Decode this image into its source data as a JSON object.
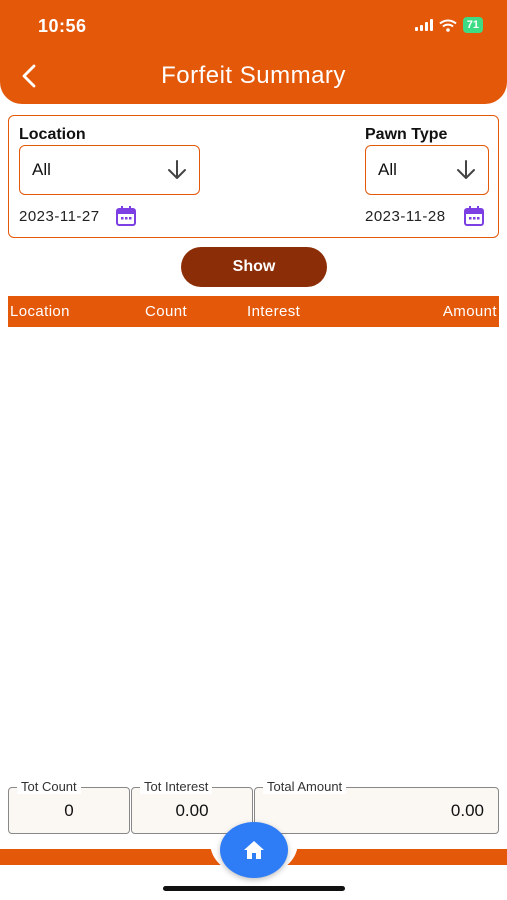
{
  "status_bar": {
    "time": "10:56",
    "battery": "71"
  },
  "header": {
    "title": "Forfeit Summary"
  },
  "filters": {
    "location_label": "Location",
    "location_value": "All",
    "pawn_type_label": "Pawn Type",
    "pawn_type_value": "All",
    "from_date": "2023-11-27",
    "to_date": "2023-11-28"
  },
  "show_button": "Show",
  "table": {
    "columns": [
      "Location",
      "Count",
      "Interest",
      "Amount"
    ],
    "rows": []
  },
  "totals": {
    "count_label": "Tot Count",
    "count_value": "0",
    "interest_label": "Tot Interest",
    "interest_value": "0.00",
    "amount_label": "Total Amount",
    "amount_value": "0.00"
  },
  "colors": {
    "accent": "#E4580A",
    "button": "#8B2E07",
    "home": "#2F7DF6",
    "calendar": "#7B3FE4"
  }
}
